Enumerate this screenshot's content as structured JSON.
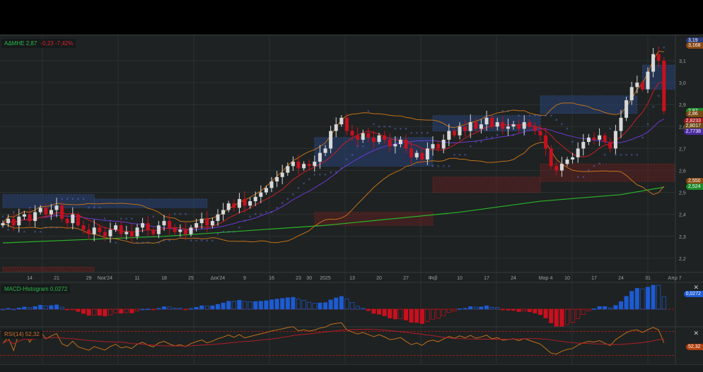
{
  "legend": {
    "symbol": "ΑΔΜΗΕ",
    "last": "2,87",
    "change": "-0,23",
    "change_pct": "-7,42%"
  },
  "macd_legend": {
    "label": "MACD-Histogram",
    "value": "0,0272"
  },
  "rsi_legend": {
    "label": "RSI(14)",
    "value": "52,32"
  },
  "right_badges": [
    {
      "text": "3,19",
      "color": "#2a3a7a",
      "price": 3.19
    },
    {
      "text": "3,168",
      "color": "#8a4a14",
      "price": 3.168
    },
    {
      "text": "2,87",
      "color": "#1d8a2a",
      "price": 2.87
    },
    {
      "text": "2,86",
      "color": "#7a4a14",
      "price": 2.855
    },
    {
      "text": "2,8233",
      "color": "#a01818",
      "price": 2.8233
    },
    {
      "text": "2,8017",
      "color": "#6a4a1a",
      "price": 2.8017
    },
    {
      "text": "2,7738",
      "color": "#4a2aa0",
      "price": 2.7738
    },
    {
      "text": "2,550",
      "color": "#8a4a14",
      "price": 2.55
    },
    {
      "text": "2,524",
      "color": "#1d8a2a",
      "price": 2.524
    }
  ],
  "macd_badge": {
    "text": "0,0272",
    "color": "#1d5bd0"
  },
  "rsi_badge": {
    "text": "52,32",
    "color": "#b0400e"
  },
  "colors": {
    "up": "#d8d8d8",
    "down": "#c8101e",
    "bb": "#c0701a",
    "ma_fast": "#c81e28",
    "ma_mid": "#6a3ad0",
    "ma200": "#2ab52a",
    "sar": "#5a6ad0",
    "zone_blue": "#2a4a8a",
    "zone_red": "#6a1e1e"
  },
  "chart_data": {
    "type": "candlestick",
    "title": "ΑΔΜΗΕ daily",
    "ylim": [
      2.13,
      3.18
    ],
    "y_ticks": [
      2.2,
      2.3,
      2.4,
      2.5,
      2.6,
      2.7,
      2.8,
      2.9,
      3.0,
      3.1
    ],
    "y_tick_labels": [
      "2,2",
      "2,3",
      "2,4",
      "2,5",
      "2,6",
      "2,7",
      "2,8",
      "2,9",
      "3,0",
      "3,1"
    ],
    "x_ticks": [
      {
        "i": 5,
        "label": "14"
      },
      {
        "i": 10,
        "label": "21"
      },
      {
        "i": 16,
        "label": "29"
      },
      {
        "i": 19,
        "label": "Noε'24"
      },
      {
        "i": 25,
        "label": "11"
      },
      {
        "i": 30,
        "label": "18"
      },
      {
        "i": 35,
        "label": "25"
      },
      {
        "i": 40,
        "label": "Δεκ'24"
      },
      {
        "i": 45,
        "label": "9"
      },
      {
        "i": 50,
        "label": "16"
      },
      {
        "i": 55,
        "label": "23"
      },
      {
        "i": 57,
        "label": "30"
      },
      {
        "i": 60,
        "label": "2025"
      },
      {
        "i": 65,
        "label": "13"
      },
      {
        "i": 70,
        "label": "20"
      },
      {
        "i": 75,
        "label": "27"
      },
      {
        "i": 80,
        "label": "Φεβ"
      },
      {
        "i": 85,
        "label": "10"
      },
      {
        "i": 90,
        "label": "17"
      },
      {
        "i": 95,
        "label": "24"
      },
      {
        "i": 101,
        "label": "Μαρ 4"
      },
      {
        "i": 105,
        "label": "10"
      },
      {
        "i": 110,
        "label": "17"
      },
      {
        "i": 115,
        "label": "24"
      },
      {
        "i": 120,
        "label": "31"
      },
      {
        "i": 125,
        "label": "Απρ 7"
      }
    ],
    "close": [
      2.36,
      2.38,
      2.35,
      2.39,
      2.4,
      2.37,
      2.41,
      2.43,
      2.4,
      2.42,
      2.44,
      2.38,
      2.36,
      2.4,
      2.35,
      2.33,
      2.31,
      2.34,
      2.32,
      2.3,
      2.33,
      2.35,
      2.31,
      2.32,
      2.3,
      2.34,
      2.36,
      2.33,
      2.31,
      2.35,
      2.37,
      2.34,
      2.32,
      2.33,
      2.31,
      2.34,
      2.36,
      2.38,
      2.35,
      2.37,
      2.4,
      2.42,
      2.45,
      2.43,
      2.47,
      2.44,
      2.46,
      2.48,
      2.5,
      2.52,
      2.55,
      2.57,
      2.59,
      2.62,
      2.64,
      2.61,
      2.63,
      2.62,
      2.64,
      2.68,
      2.7,
      2.78,
      2.81,
      2.84,
      2.78,
      2.76,
      2.74,
      2.77,
      2.75,
      2.73,
      2.76,
      2.74,
      2.71,
      2.72,
      2.74,
      2.7,
      2.66,
      2.68,
      2.65,
      2.7,
      2.72,
      2.7,
      2.74,
      2.78,
      2.76,
      2.8,
      2.78,
      2.82,
      2.79,
      2.81,
      2.84,
      2.8,
      2.82,
      2.79,
      2.8,
      2.81,
      2.79,
      2.82,
      2.8,
      2.78,
      2.76,
      2.7,
      2.62,
      2.6,
      2.63,
      2.65,
      2.66,
      2.7,
      2.73,
      2.75,
      2.74,
      2.76,
      2.73,
      2.7,
      2.78,
      2.84,
      2.92,
      2.98,
      3.0,
      2.97,
      3.05,
      3.13,
      3.1,
      2.87
    ],
    "ma200": [
      [
        0,
        2.27
      ],
      [
        30,
        2.3
      ],
      [
        60,
        2.35
      ],
      [
        85,
        2.41
      ],
      [
        100,
        2.46
      ],
      [
        115,
        2.49
      ],
      [
        123,
        2.524
      ]
    ],
    "zones": [
      {
        "kind": "supply",
        "from": 0,
        "to": 17,
        "hi": 2.49,
        "lo": 2.43
      },
      {
        "kind": "supply",
        "from": 17,
        "to": 38,
        "hi": 2.47,
        "lo": 2.43
      },
      {
        "kind": "supply",
        "from": 58,
        "to": 80,
        "hi": 2.75,
        "lo": 2.62
      },
      {
        "kind": "supply",
        "from": 80,
        "to": 100,
        "hi": 2.85,
        "lo": 2.78
      },
      {
        "kind": "supply",
        "from": 100,
        "to": 118,
        "hi": 2.94,
        "lo": 2.86
      },
      {
        "kind": "supply",
        "from": 119,
        "to": 125,
        "hi": 3.08,
        "lo": 2.97
      },
      {
        "kind": "demand",
        "from": 58,
        "to": 80,
        "hi": 2.41,
        "lo": 2.35
      },
      {
        "kind": "demand",
        "from": 80,
        "to": 100,
        "hi": 2.57,
        "lo": 2.5
      },
      {
        "kind": "demand",
        "from": 100,
        "to": 125,
        "hi": 2.63,
        "lo": 2.55
      },
      {
        "kind": "demand",
        "from": 0,
        "to": 17,
        "hi": 2.16,
        "lo": 2.14
      }
    ],
    "rsi_levels": [
      70,
      30
    ],
    "macd_zero": 0
  }
}
